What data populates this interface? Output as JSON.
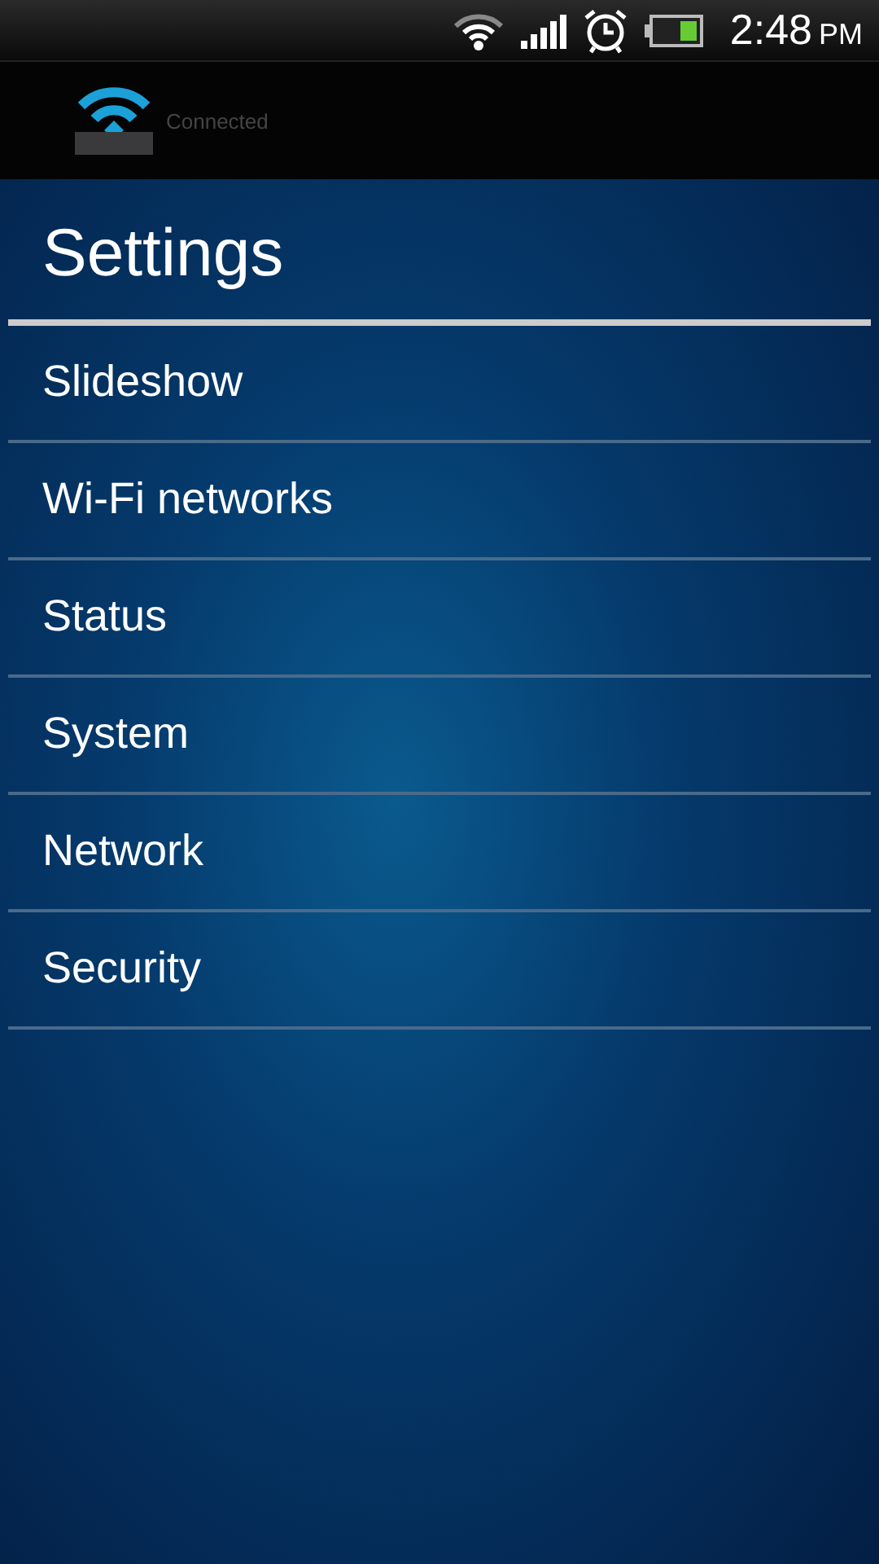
{
  "status_bar": {
    "time": "2:48",
    "meridiem": "PM"
  },
  "header": {
    "status": "Connected"
  },
  "title": "Settings",
  "menu": [
    {
      "label": "Slideshow"
    },
    {
      "label": "Wi-Fi networks"
    },
    {
      "label": "Status"
    },
    {
      "label": "System"
    },
    {
      "label": "Network"
    },
    {
      "label": "Security"
    }
  ]
}
